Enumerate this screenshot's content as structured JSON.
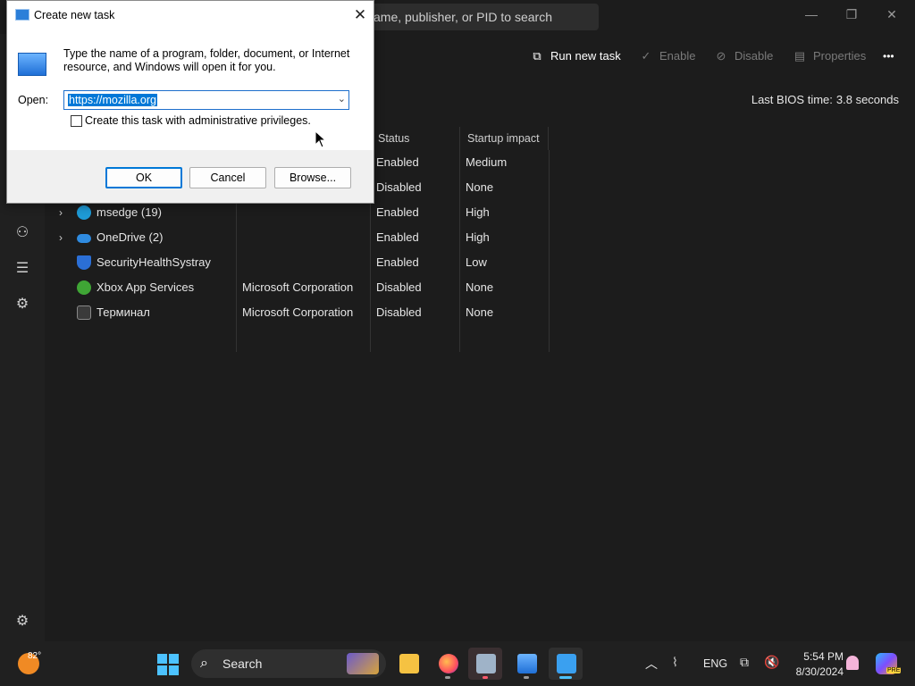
{
  "taskmanager": {
    "search_placeholder": "ame, publisher, or PID to search",
    "toolbar": {
      "run_new_task": "Run new task",
      "enable": "Enable",
      "disable": "Disable",
      "properties": "Properties",
      "more": "•••"
    },
    "bios_label": "Last BIOS time:",
    "bios_value": "3.8 seconds",
    "columns": {
      "status": "Status",
      "startup_impact": "Startup impact"
    },
    "rows": [
      {
        "name": "",
        "publisher": "",
        "status": "Enabled",
        "impact": "Medium",
        "expandable": false
      },
      {
        "name": "",
        "publisher": "",
        "status": "Disabled",
        "impact": "None",
        "expandable": false
      },
      {
        "name": "msedge (19)",
        "publisher": "",
        "status": "Enabled",
        "impact": "High",
        "expandable": true,
        "icon": "edge-icon"
      },
      {
        "name": "OneDrive (2)",
        "publisher": "",
        "status": "Enabled",
        "impact": "High",
        "expandable": true,
        "icon": "onedrive-icon"
      },
      {
        "name": "SecurityHealthSystray",
        "publisher": "",
        "status": "Enabled",
        "impact": "Low",
        "expandable": false,
        "icon": "shield-icon"
      },
      {
        "name": "Xbox App Services",
        "publisher": "Microsoft Corporation",
        "status": "Disabled",
        "impact": "None",
        "expandable": false,
        "icon": "xbox-icon"
      },
      {
        "name": "Терминал",
        "publisher": "Microsoft Corporation",
        "status": "Disabled",
        "impact": "None",
        "expandable": false,
        "icon": "terminal-icon"
      }
    ]
  },
  "dialog": {
    "title": "Create new task",
    "close": "✕",
    "description": "Type the name of a program, folder, document, or Internet resource, and Windows will open it for you.",
    "open_label": "Open:",
    "open_value": "https://mozilla.org",
    "admin_checkbox_label": "Create this task with administrative privileges.",
    "admin_checked": false,
    "ok": "OK",
    "cancel": "Cancel",
    "browse": "Browse..."
  },
  "taskbar": {
    "weather_temp": "82°",
    "search_label": "Search",
    "language": "ENG",
    "time": "5:54 PM",
    "date": "8/30/2024",
    "pre_tag": "PRE",
    "accent": "#4cc2ff"
  }
}
